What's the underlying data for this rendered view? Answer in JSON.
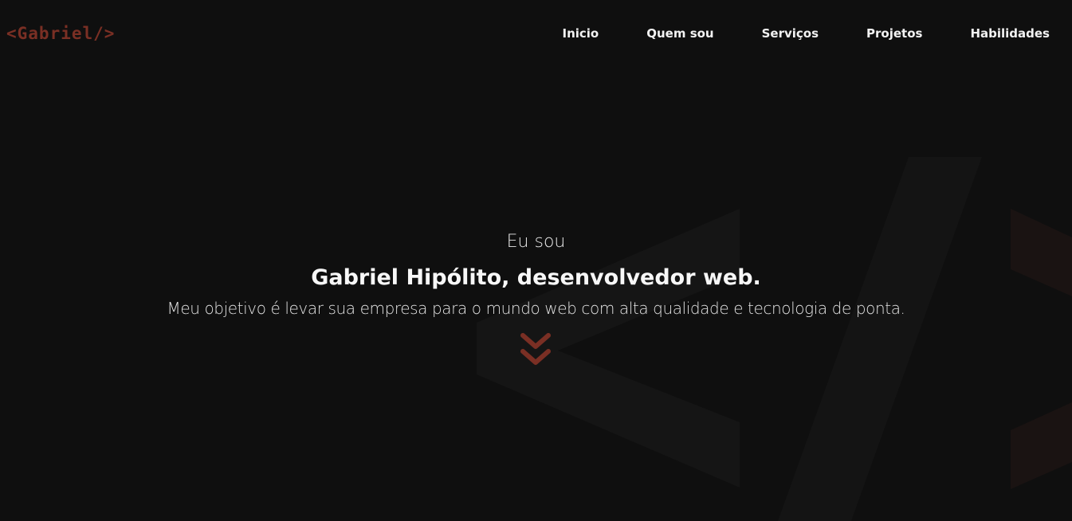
{
  "header": {
    "logo_text": "<Gabriel/>",
    "nav": [
      {
        "label": "Inicio"
      },
      {
        "label": "Quem sou"
      },
      {
        "label": "Serviços"
      },
      {
        "label": "Projetos"
      },
      {
        "label": "Habilidades"
      }
    ]
  },
  "hero": {
    "intro": "Eu sou",
    "title": "Gabriel Hipólito, desenvolvedor web.",
    "subtitle": "Meu objetivo é levar sua empresa para o mundo web com alta qualidade e tecnologia de ponta.",
    "scroll_icon": "double-chevron-down-icon"
  },
  "colors": {
    "background": "#0f0f0f",
    "accent": "#7a2f24",
    "text": "#f2f2f2",
    "bg_shape": "#161616",
    "bg_shape_accent": "#1b1311"
  }
}
